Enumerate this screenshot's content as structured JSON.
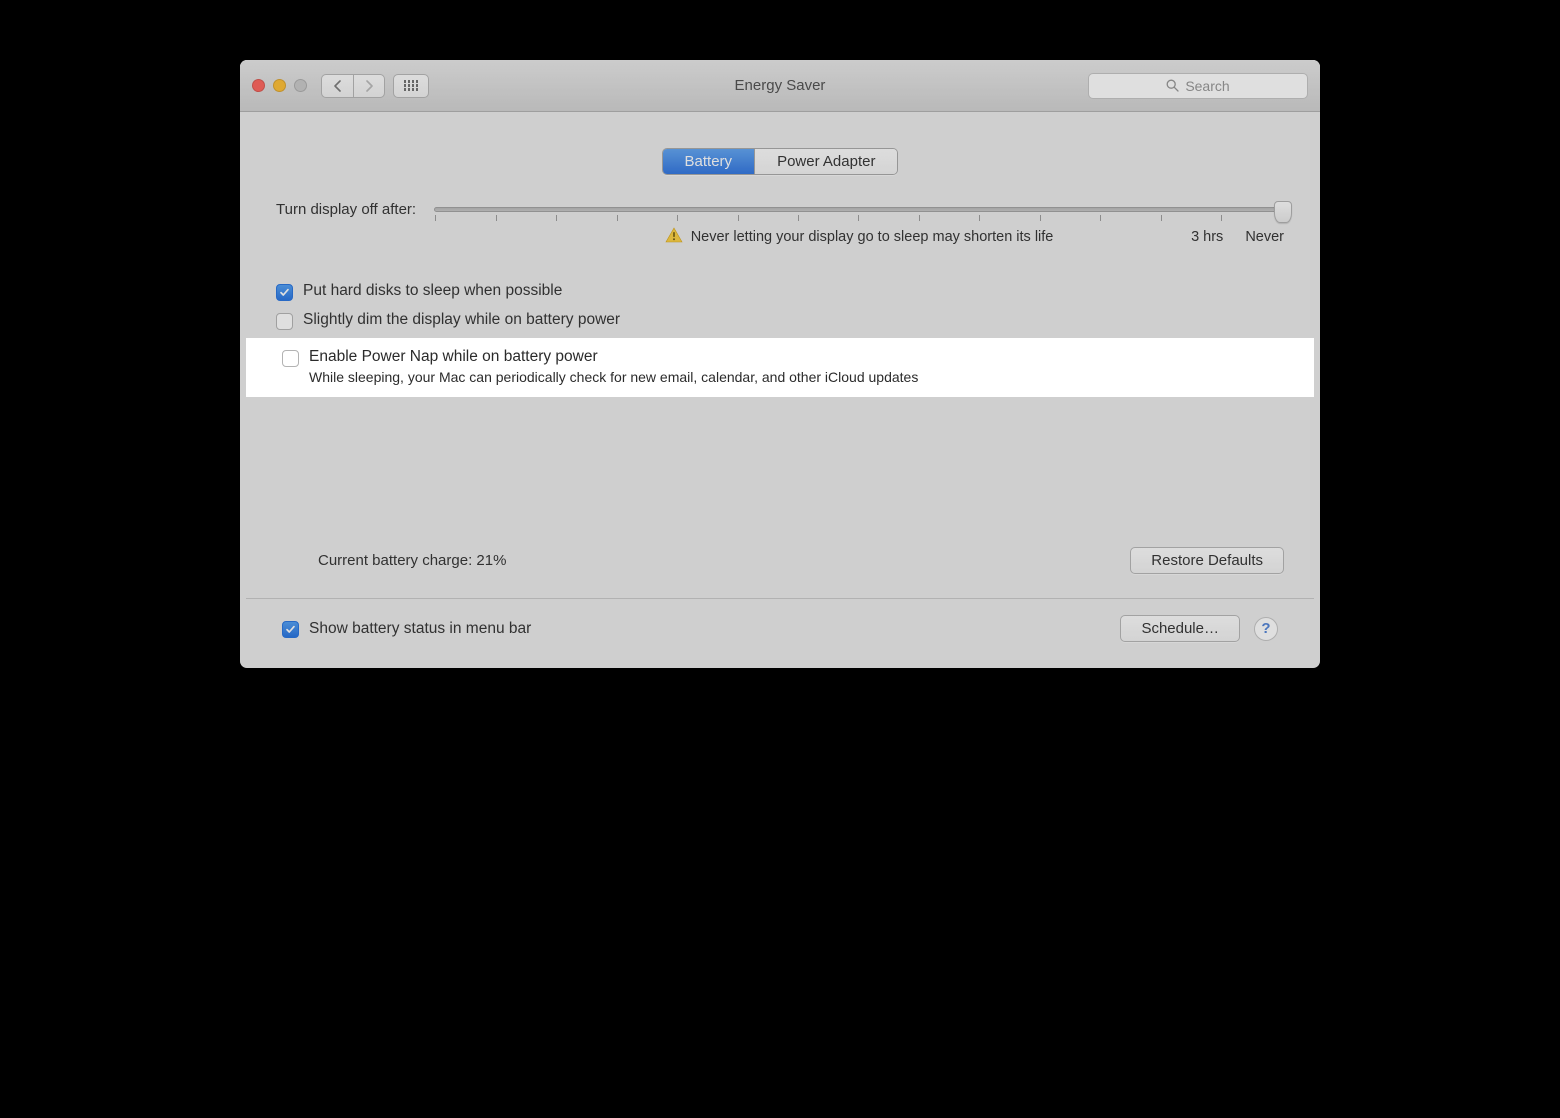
{
  "window": {
    "title": "Energy Saver"
  },
  "search": {
    "placeholder": "Search"
  },
  "tabs": {
    "battery": "Battery",
    "power_adapter": "Power Adapter"
  },
  "slider": {
    "label": "Turn display off after:",
    "warning": "Never letting your display go to sleep may shorten its life",
    "label_3hrs": "3 hrs",
    "label_never": "Never"
  },
  "checks": {
    "hard_disks": {
      "label": "Put hard disks to sleep when possible",
      "checked": true
    },
    "dim": {
      "label": "Slightly dim the display while on battery power",
      "checked": false
    },
    "power_nap": {
      "label": "Enable Power Nap while on battery power",
      "sub": "While sleeping, your Mac can periodically check for new email, calendar, and other iCloud updates",
      "checked": false
    }
  },
  "status": {
    "charge_label": "Current battery charge: 21%"
  },
  "buttons": {
    "restore": "Restore Defaults",
    "schedule": "Schedule…"
  },
  "footer": {
    "show_menubar": {
      "label": "Show battery status in menu bar",
      "checked": true
    }
  },
  "help": {
    "label": "?"
  }
}
